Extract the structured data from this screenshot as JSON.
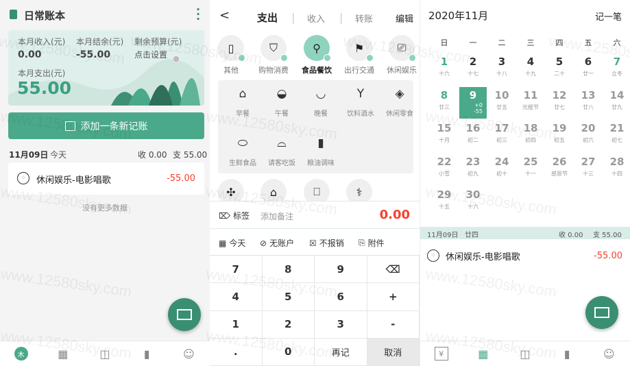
{
  "watermark": "www.12580sky.com",
  "home": {
    "title": "日常账本",
    "income_label": "本月收入(元)",
    "income_value": "0.00",
    "balance_label": "本月结余(元)",
    "balance_value": "-55.00",
    "budget_label": "剩余预算(元)",
    "budget_value": "点击设置",
    "expense_label": "本月支出(元)",
    "expense_value": "55.00",
    "add_button": "添加一条新记账",
    "day": {
      "date": "11月09日",
      "weekday": "今天",
      "income": "收 0.00",
      "expense": "支 55.00"
    },
    "entry": {
      "name": "休闲娱乐-电影唱歌",
      "amount": "-55.00"
    },
    "no_more": "没有更多数据"
  },
  "add": {
    "back": "<",
    "tabs": [
      "支出",
      "收入",
      "转账"
    ],
    "edit": "编辑",
    "categories": [
      {
        "label": "其他",
        "icon": "▯"
      },
      {
        "label": "购物消费",
        "icon": "⛉"
      },
      {
        "label": "食品餐饮",
        "icon": "⚲",
        "selected": true
      },
      {
        "label": "出行交通",
        "icon": "⚑"
      },
      {
        "label": "休闲娱乐",
        "icon": "⎚"
      }
    ],
    "subcategories": [
      {
        "label": "早餐",
        "icon": "⌂"
      },
      {
        "label": "午餐",
        "icon": "◒"
      },
      {
        "label": "晚餐",
        "icon": "◡"
      },
      {
        "label": "饮料酒水",
        "icon": "Y"
      },
      {
        "label": "休闲零食",
        "icon": "◈"
      },
      {
        "label": "生鲜食品",
        "icon": "⬭"
      },
      {
        "label": "请客吃饭",
        "icon": "⌓"
      },
      {
        "label": "粮油调味",
        "icon": "▮"
      }
    ],
    "more_category_icons": [
      "✣",
      "⌂",
      "⎕",
      "⚕"
    ],
    "tag_label": "标签",
    "note_placeholder": "添加备注",
    "amount": "0.00",
    "options": [
      "今天",
      "无账户",
      "不报销",
      "附件"
    ],
    "keys": [
      "7",
      "8",
      "9",
      "⌫",
      "4",
      "5",
      "6",
      "+",
      "1",
      "2",
      "3",
      "-",
      ".",
      "0",
      "再记",
      "取消"
    ]
  },
  "calendar": {
    "title": "2020年11月",
    "add": "记一笔",
    "weekdays": [
      "日",
      "一",
      "二",
      "三",
      "四",
      "五",
      "六"
    ],
    "days": [
      {
        "n": "1",
        "l": "十六"
      },
      {
        "n": "2",
        "l": "十七"
      },
      {
        "n": "3",
        "l": "十八"
      },
      {
        "n": "4",
        "l": "十九"
      },
      {
        "n": "5",
        "l": "二十"
      },
      {
        "n": "6",
        "l": "廿一"
      },
      {
        "n": "7",
        "l": "立冬"
      },
      {
        "n": "8",
        "l": "廿三"
      },
      {
        "n": "9",
        "l": "+0",
        "l2": "-55",
        "selected": true
      },
      {
        "n": "10",
        "l": "廿五"
      },
      {
        "n": "11",
        "l": "光棍节"
      },
      {
        "n": "12",
        "l": "廿七"
      },
      {
        "n": "13",
        "l": "廿八"
      },
      {
        "n": "14",
        "l": "廿九"
      },
      {
        "n": "15",
        "l": "十月"
      },
      {
        "n": "16",
        "l": "初二"
      },
      {
        "n": "17",
        "l": "初三"
      },
      {
        "n": "18",
        "l": "初四"
      },
      {
        "n": "19",
        "l": "初五"
      },
      {
        "n": "20",
        "l": "初六"
      },
      {
        "n": "21",
        "l": "初七"
      },
      {
        "n": "22",
        "l": "小雪"
      },
      {
        "n": "23",
        "l": "初九"
      },
      {
        "n": "24",
        "l": "初十"
      },
      {
        "n": "25",
        "l": "十一"
      },
      {
        "n": "26",
        "l": "感恩节"
      },
      {
        "n": "27",
        "l": "十三"
      },
      {
        "n": "28",
        "l": "十四"
      },
      {
        "n": "29",
        "l": "十五"
      },
      {
        "n": "30",
        "l": "十六"
      }
    ],
    "summary": {
      "date": "11月09日",
      "lunar": "廿四",
      "income": "收 0.00",
      "expense": "支 55.00"
    },
    "entry": {
      "name": "休闲娱乐-电影唱歌",
      "amount": "-55.00"
    }
  },
  "colors": {
    "accent": "#4aa98a",
    "fab": "#3a8f73",
    "expense": "#f5412d"
  }
}
